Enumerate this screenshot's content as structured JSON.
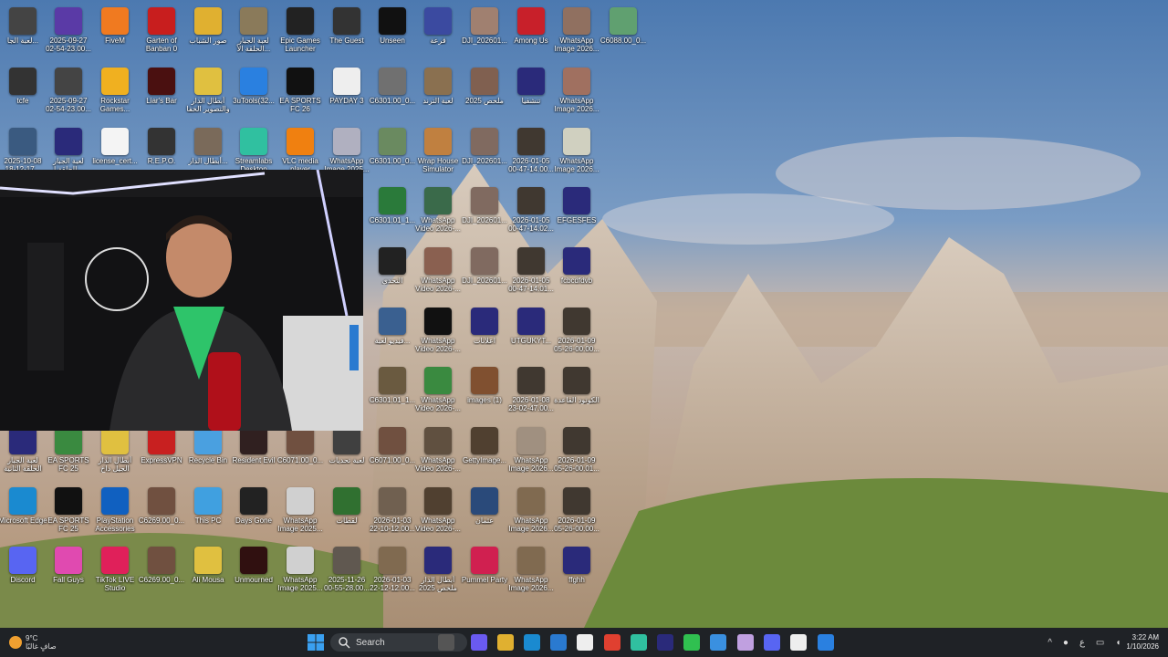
{
  "desktop_icons": [
    {
      "label": "لعبة الجا...",
      "color": "#444"
    },
    {
      "label": "2025-09-27 02-54-23.00...",
      "color": "#5a3aa6"
    },
    {
      "label": "FiveM",
      "color": "#f07a20"
    },
    {
      "label": "Garten of Banban 0",
      "color": "#c81e1e"
    },
    {
      "label": "صور الشباب",
      "color": "#e0b030"
    },
    {
      "label": "لعبة الجبار الحلقة الأ...",
      "color": "#8a7a5a"
    },
    {
      "label": "Epic Games Launcher",
      "color": "#222"
    },
    {
      "label": "The Guest",
      "color": "#333"
    },
    {
      "label": "Unseen",
      "color": "#111"
    },
    {
      "label": "قرعة",
      "color": "#3b4aa0"
    },
    {
      "label": "DJI_202601...",
      "color": "#a08070"
    },
    {
      "label": "Among Us",
      "color": "#c8202a"
    },
    {
      "label": "WhatsApp Image 2026...",
      "color": "#907060"
    },
    {
      "label": "C6088.00_0...",
      "color": "#60a070"
    },
    {
      "label": "tcfe",
      "color": "#333"
    },
    {
      "label": "2025-09-27 02-54-23.00...",
      "color": "#444"
    },
    {
      "label": "Rockstar Games...",
      "color": "#f0b020"
    },
    {
      "label": "Liar's Bar",
      "color": "#4a1010"
    },
    {
      "label": "أبطال الدار والتصوير الخفا",
      "color": "#e0c040"
    },
    {
      "label": "3uTools(32...",
      "color": "#2a80e0"
    },
    {
      "label": "EA SPORTS FC 26",
      "color": "#111"
    },
    {
      "label": "PAYDAY 3",
      "color": "#eee"
    },
    {
      "label": "C6301.00_0...",
      "color": "#707070"
    },
    {
      "label": "لعبة الترند",
      "color": "#8a7050"
    },
    {
      "label": "ملخص 2025",
      "color": "#806050"
    },
    {
      "label": "تنشفيا",
      "color": "#2a2a7a"
    },
    {
      "label": "WhatsApp Image 2026...",
      "color": "#a07060"
    },
    {
      "label": "2025-10-08 18-12-17...",
      "color": "#3a5a80"
    },
    {
      "label": "لعبة الجبار الحلقة ا...",
      "color": "#2a2a7a"
    },
    {
      "label": "license_cert...",
      "color": "#f4f4f4"
    },
    {
      "label": "R.E.P.O.",
      "color": "#333"
    },
    {
      "label": "أبطال الدار...",
      "color": "#7a6a5a"
    },
    {
      "label": "Streamlabs Desktop",
      "color": "#30c0a0"
    },
    {
      "label": "VLC media player",
      "color": "#f08010"
    },
    {
      "label": "WhatsApp Image 2025...",
      "color": "#b0b0c0"
    },
    {
      "label": "C6301.00_0...",
      "color": "#6a8a60"
    },
    {
      "label": "Wrap House Simulator",
      "color": "#c08040"
    },
    {
      "label": "DJI_202601...",
      "color": "#806a60"
    },
    {
      "label": "2026-01-05 00-47-14.00...",
      "color": "#403830"
    },
    {
      "label": "WhatsApp Image 2026...",
      "color": "#d0d0c0"
    },
    {
      "label": "C6301.01_1...",
      "color": "#2a7a3a"
    },
    {
      "label": "WhatsApp Video 2026-...",
      "color": "#3a6a4a"
    },
    {
      "label": "DJI_202601...",
      "color": "#806a60"
    },
    {
      "label": "2026-01-05 00-47-14.02...",
      "color": "#403830"
    },
    {
      "label": "EFGESFES",
      "color": "#2a2a7a"
    },
    {
      "label": "التحدي",
      "color": "#222"
    },
    {
      "label": "WhatsApp Video 2026-...",
      "color": "#8a6050"
    },
    {
      "label": "DJI_202601...",
      "color": "#806a60"
    },
    {
      "label": "2026-01-05 00-47-14.01...",
      "color": "#403830"
    },
    {
      "label": "fcbcdfdvb",
      "color": "#2a2a7a"
    },
    {
      "label": "فيديو لعبة...",
      "color": "#3a6090"
    },
    {
      "label": "WhatsApp Video 2026-...",
      "color": "#111"
    },
    {
      "label": "اعلانات",
      "color": "#2a2a7a"
    },
    {
      "label": "UTGUKYT...",
      "color": "#2a2a7a"
    },
    {
      "label": "2026-01-09 05-26-00.00...",
      "color": "#403830"
    },
    {
      "label": "C6301.01_1...",
      "color": "#6a5a40"
    },
    {
      "label": "WhatsApp Video 2026-...",
      "color": "#3a8a40"
    },
    {
      "label": "images (1)",
      "color": "#805030"
    },
    {
      "label": "2026-01-08 23-02-47.00...",
      "color": "#403830"
    },
    {
      "label": "الكوتود القاعدة",
      "color": "#403830"
    },
    {
      "label": "C6071.00_0...",
      "color": "#705040"
    },
    {
      "label": "WhatsApp Video 2026-...",
      "color": "#605040"
    },
    {
      "label": "GettyImage...",
      "color": "#504030"
    },
    {
      "label": "WhatsApp Image 2026...",
      "color": "#a09080"
    },
    {
      "label": "2026-01-09 05-26-00.01...",
      "color": "#403830"
    },
    {
      "label": "لعبة الجبار الحلقة الثانية",
      "color": "#2a2a7a"
    },
    {
      "label": "EA SPORTS FC 25",
      "color": "#3a8a40"
    },
    {
      "label": "أبطال الدار الجيل داخ",
      "color": "#e0c040"
    },
    {
      "label": "ExpressVPN",
      "color": "#c82020"
    },
    {
      "label": "Recycle Bin",
      "color": "#4aa0e0"
    },
    {
      "label": "Resident Evil",
      "color": "#302020"
    },
    {
      "label": "C6071.00_0...",
      "color": "#705040"
    },
    {
      "label": "لعبة تحديات",
      "color": "#404040"
    },
    {
      "label": "Microsoft Edge",
      "color": "#1a8ad0"
    },
    {
      "label": "EA SPORTS FC 25",
      "color": "#111"
    },
    {
      "label": "PlayStation Accessories",
      "color": "#1060c0"
    },
    {
      "label": "C6269.00_0...",
      "color": "#705040"
    },
    {
      "label": "This PC",
      "color": "#40a0e0"
    },
    {
      "label": "Days Gone",
      "color": "#222"
    },
    {
      "label": "WhatsApp Image 2025...",
      "color": "#d0d0d0"
    },
    {
      "label": "لقطات",
      "color": "#307030"
    },
    {
      "label": "2026-01-03 22-10-12.00...",
      "color": "#706050"
    },
    {
      "label": "WhatsApp Video 2026-...",
      "color": "#504030"
    },
    {
      "label": "عثمان",
      "color": "#2a4a7a"
    },
    {
      "label": "WhatsApp Image 2026...",
      "color": "#806a50"
    },
    {
      "label": "2026-01-09 05-26-00.00...",
      "color": "#403830"
    },
    {
      "label": "Discord",
      "color": "#5865f2"
    },
    {
      "label": "Fall Guys",
      "color": "#e04ab0"
    },
    {
      "label": "TikTok LIVE Studio",
      "color": "#e0205a"
    },
    {
      "label": "C6269.00_0...",
      "color": "#705040"
    },
    {
      "label": "Ali Mousa",
      "color": "#e0c040"
    },
    {
      "label": "Unmourned",
      "color": "#301010"
    },
    {
      "label": "WhatsApp Image 2025...",
      "color": "#d0d0d0"
    },
    {
      "label": "2025-11-26 00-55-28.00...",
      "color": "#605850"
    },
    {
      "label": "2026-01-03 22-12-12.00...",
      "color": "#806a50"
    },
    {
      "label": "أبطال الدار ملخص 2025",
      "color": "#2a2a7a"
    },
    {
      "label": "Pummel Party",
      "color": "#d02050"
    },
    {
      "label": "WhatsApp Image 2026...",
      "color": "#806a50"
    },
    {
      "label": "ffghh",
      "color": "#2a2a7a"
    }
  ],
  "taskbar": {
    "weather_temp": "9°C",
    "weather_text": "صافٍ غالبًا",
    "search_label": "Search",
    "apps": [
      {
        "name": "task-view",
        "color": "#555"
      },
      {
        "name": "copilot",
        "color": "#6a5af0"
      },
      {
        "name": "file-explorer",
        "color": "#e0b030"
      },
      {
        "name": "edge",
        "color": "#1a8ad0"
      },
      {
        "name": "store",
        "color": "#2a7ad0"
      },
      {
        "name": "maps",
        "color": "#eee"
      },
      {
        "name": "chrome",
        "color": "#e04030"
      },
      {
        "name": "streamlabs",
        "color": "#30c0a0"
      },
      {
        "name": "premiere",
        "color": "#2a2a7a"
      },
      {
        "name": "whatsapp",
        "color": "#30c050"
      },
      {
        "name": "app",
        "color": "#3a90e0"
      },
      {
        "name": "media",
        "color": "#c0a0e0"
      },
      {
        "name": "discord",
        "color": "#5865f2"
      },
      {
        "name": "capcut",
        "color": "#eee"
      },
      {
        "name": "app2",
        "color": "#2a80e0"
      }
    ],
    "tray_lang": "ع",
    "time": "3:22 AM",
    "date": "1/10/2026"
  }
}
